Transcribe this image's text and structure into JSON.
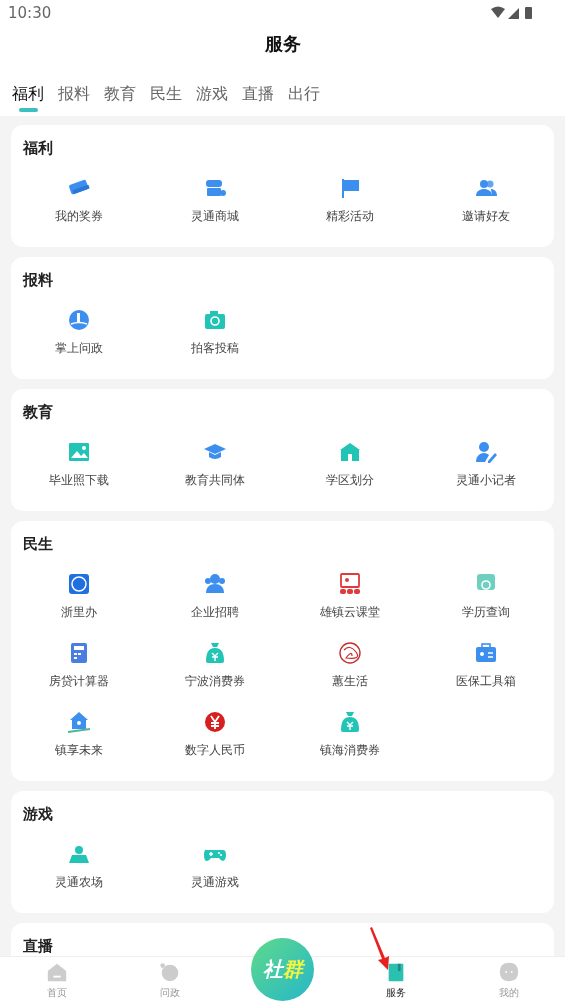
{
  "status_bar": {
    "time": "10:30"
  },
  "header": {
    "title": "服务"
  },
  "tabs": [
    {
      "label": "福利",
      "selected": true
    },
    {
      "label": "报料",
      "selected": false
    },
    {
      "label": "教育",
      "selected": false
    },
    {
      "label": "民生",
      "selected": false
    },
    {
      "label": "游戏",
      "selected": false
    },
    {
      "label": "直播",
      "selected": false
    },
    {
      "label": "出行",
      "selected": false
    }
  ],
  "sections": [
    {
      "title": "福利",
      "items": [
        {
          "label": "我的奖券"
        },
        {
          "label": "灵通商城"
        },
        {
          "label": "精彩活动"
        },
        {
          "label": "邀请好友"
        }
      ]
    },
    {
      "title": "报料",
      "items": [
        {
          "label": "掌上问政"
        },
        {
          "label": "拍客投稿"
        }
      ]
    },
    {
      "title": "教育",
      "items": [
        {
          "label": "毕业照下载"
        },
        {
          "label": "教育共同体"
        },
        {
          "label": "学区划分"
        },
        {
          "label": "灵通小记者"
        }
      ]
    },
    {
      "title": "民生",
      "items": [
        {
          "label": "浙里办"
        },
        {
          "label": "企业招聘"
        },
        {
          "label": "雄镇云课堂"
        },
        {
          "label": "学历查询"
        },
        {
          "label": "房贷计算器"
        },
        {
          "label": "宁波消费券"
        },
        {
          "label": "蕙生活"
        },
        {
          "label": "医保工具箱"
        },
        {
          "label": "镇享未来"
        },
        {
          "label": "数字人民币"
        },
        {
          "label": "镇海消费券"
        }
      ]
    },
    {
      "title": "游戏",
      "items": [
        {
          "label": "灵通农场"
        },
        {
          "label": "灵通游戏"
        }
      ]
    },
    {
      "title": "直播"
    }
  ],
  "bottom_nav": {
    "items": [
      {
        "label": "首页",
        "selected": false
      },
      {
        "label": "问政",
        "selected": false
      },
      {
        "label": "服务",
        "selected": true
      },
      {
        "label": "我的",
        "selected": false
      }
    ],
    "center_button": {
      "text_1": "社",
      "text_2": "群"
    }
  }
}
